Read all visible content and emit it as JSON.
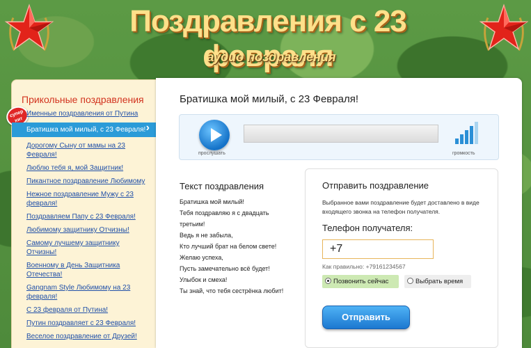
{
  "header": {
    "title": "Поздравления с 23 февраля",
    "subtitle": "аудио поздравления"
  },
  "sidebar": {
    "title": "Прикольные поздравления",
    "badge": "супер хит",
    "items": [
      {
        "label": "Именные поздравления от Путина"
      },
      {
        "label": "Братишка мой милый, с 23 Февраля!"
      },
      {
        "label": "Дорогому Сыну от мамы на 23 Февраля!"
      },
      {
        "label": "Люблю тебя я, мой Защитник!"
      },
      {
        "label": "Пикантное поздравление Любимому"
      },
      {
        "label": "Нежное поздравление Мужу с 23 февраля!"
      },
      {
        "label": "Поздравляем Папу с 23 Февраля!"
      },
      {
        "label": "Любимому защитнику Отчизны!"
      },
      {
        "label": "Самому лучшему защитнику Отчизны!"
      },
      {
        "label": "Военному в День Защитника Отечества!"
      },
      {
        "label": "Gangnam Style Любимому на 23 февраля!"
      },
      {
        "label": "С 23 февраля от Путина!"
      },
      {
        "label": "Путин поздравляет с 23 Февраля!"
      },
      {
        "label": "Веселое поздравление от Друзей!"
      }
    ]
  },
  "main": {
    "title": "Братишка мой милый, с 23 Февраля!",
    "player": {
      "play_label": "прослушать",
      "volume_label": "громкость",
      "volume_level": 4
    },
    "lyrics_title": "Текст поздравления",
    "lyrics": [
      "Братишка мой милый!",
      "Тебя поздравляю я с двадцать",
      "третьим!",
      "Ведь я не забыла,",
      "Кто лучший брат на белом свете!",
      "Желаю успеха,",
      "Пусть замечательно всё будет!",
      "Улыбок и смеха!",
      "Ты знай, что тебя сестрёнка любит!"
    ],
    "send": {
      "title": "Отправить поздравление",
      "description": "Выбранное вами поздравление будет доставлено в виде входящего звонка на телефон получателя.",
      "phone_label": "Телефон получателя:",
      "phone_value": "+7",
      "phone_hint": "Как правильно: +79161234567",
      "option_now": "Позвонить сейчас",
      "option_time": "Выбрать время",
      "submit": "Отправить"
    }
  },
  "colors": {
    "accent": "#2b9bd8",
    "title_gold": "#ffe08a",
    "sidebar_title": "#d2331f",
    "link": "#1f4fa8"
  }
}
